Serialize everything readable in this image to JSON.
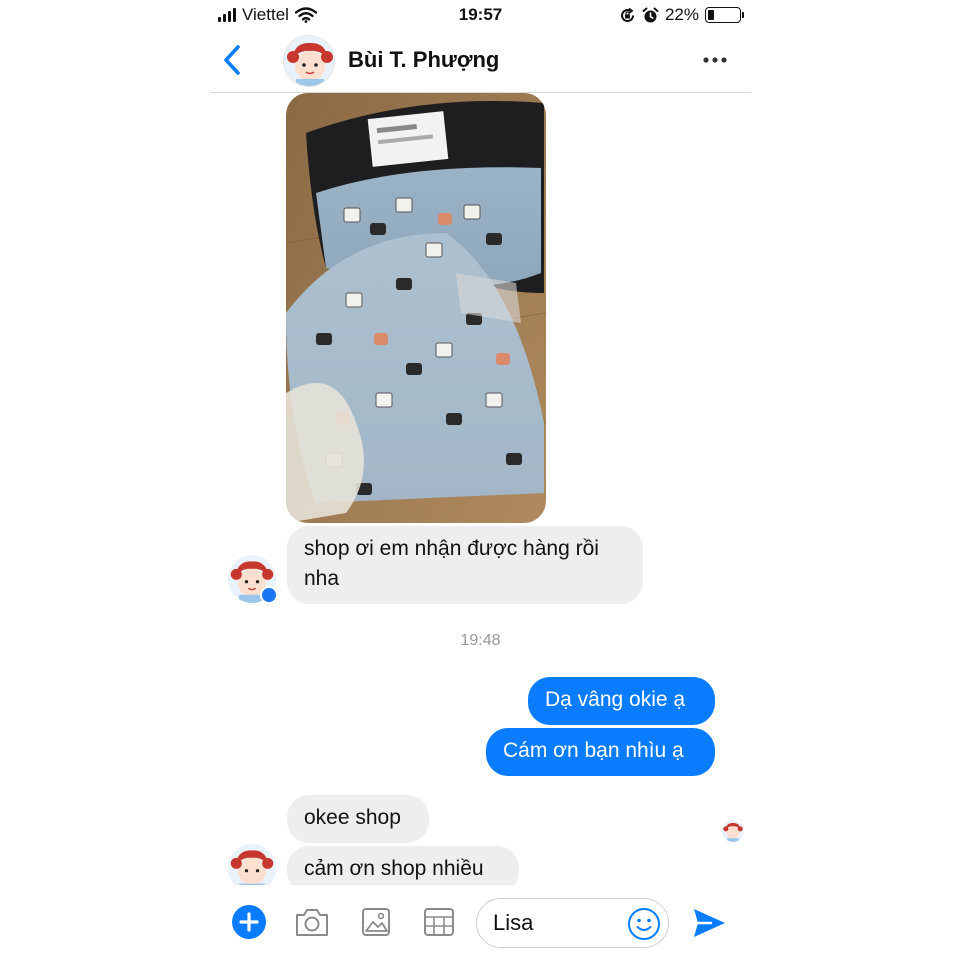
{
  "status_bar": {
    "carrier": "Viettel",
    "time": "19:57",
    "battery_percent": "22%",
    "battery_level": 0.22
  },
  "header": {
    "contact_name": "Bùi T. Phượng"
  },
  "messages": {
    "received_1": "shop ơi em nhận được hàng rồi nha",
    "timestamp": "19:48",
    "sent_1": "Dạ vâng okie ạ",
    "sent_2": "Cám ơn bạn nhìu ạ",
    "received_2": "okee shop",
    "received_3": "cảm ơn shop nhiều"
  },
  "composer": {
    "input_value": "Lisa"
  },
  "colors": {
    "accent": "#0a7cff",
    "incoming_bubble": "#eeeeef",
    "messenger_blue": "#1877f2"
  }
}
